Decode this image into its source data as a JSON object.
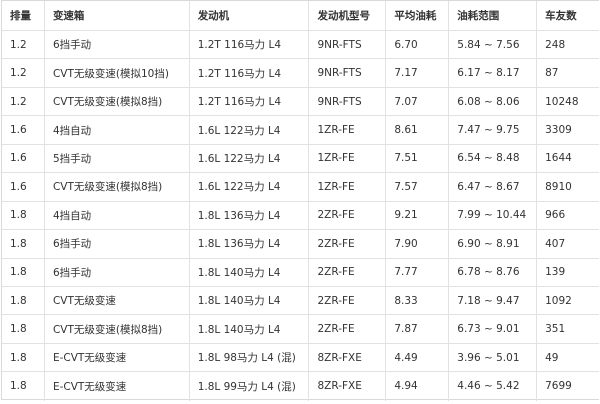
{
  "table": {
    "headers": [
      "排量",
      "变速箱",
      "发动机",
      "发动机型号",
      "平均油耗",
      "油耗范围",
      "车友数"
    ],
    "rows": [
      [
        "1.2",
        "6挡手动",
        "1.2T 116马力 L4",
        "9NR-FTS",
        "6.70",
        "5.84 ~ 7.56",
        "248"
      ],
      [
        "1.2",
        "CVT无级变速(模拟10挡)",
        "1.2T 116马力 L4",
        "9NR-FTS",
        "7.17",
        "6.17 ~ 8.17",
        "87"
      ],
      [
        "1.2",
        "CVT无级变速(模拟8挡)",
        "1.2T 116马力 L4",
        "9NR-FTS",
        "7.07",
        "6.08 ~ 8.06",
        "10248"
      ],
      [
        "1.6",
        "4挡自动",
        "1.6L 122马力 L4",
        "1ZR-FE",
        "8.61",
        "7.47 ~ 9.75",
        "3309"
      ],
      [
        "1.6",
        "5挡手动",
        "1.6L 122马力 L4",
        "1ZR-FE",
        "7.51",
        "6.54 ~ 8.48",
        "1644"
      ],
      [
        "1.6",
        "CVT无级变速(模拟8挡)",
        "1.6L 122马力 L4",
        "1ZR-FE",
        "7.57",
        "6.47 ~ 8.67",
        "8910"
      ],
      [
        "1.8",
        "4挡自动",
        "1.8L 136马力 L4",
        "2ZR-FE",
        "9.21",
        "7.99 ~ 10.44",
        "966"
      ],
      [
        "1.8",
        "6挡手动",
        "1.8L 136马力 L4",
        "2ZR-FE",
        "7.90",
        "6.90 ~ 8.91",
        "407"
      ],
      [
        "1.8",
        "6挡手动",
        "1.8L 140马力 L4",
        "2ZR-FE",
        "7.77",
        "6.78 ~ 8.76",
        "139"
      ],
      [
        "1.8",
        "CVT无级变速",
        "1.8L 140马力 L4",
        "2ZR-FE",
        "8.33",
        "7.18 ~ 9.47",
        "1092"
      ],
      [
        "1.8",
        "CVT无级变速(模拟8挡)",
        "1.8L 140马力 L4",
        "2ZR-FE",
        "7.87",
        "6.73 ~ 9.01",
        "351"
      ],
      [
        "1.8",
        "E-CVT无级变速",
        "1.8L 98马力 L4 (混)",
        "8ZR-FXE",
        "4.49",
        "3.96 ~ 5.01",
        "49"
      ],
      [
        "1.8",
        "E-CVT无级变速",
        "1.8L 99马力 L4 (混)",
        "8ZR-FXE",
        "4.94",
        "4.46 ~ 5.42",
        "7699"
      ]
    ]
  }
}
